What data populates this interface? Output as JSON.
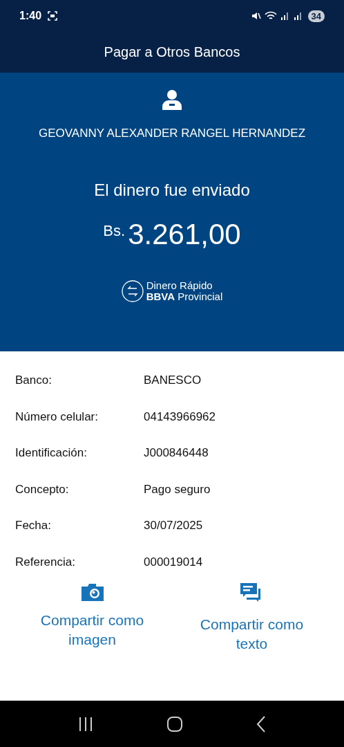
{
  "status_bar": {
    "time": "1:40",
    "battery": "34"
  },
  "header": {
    "title": "Pagar a Otros Bancos"
  },
  "receipt": {
    "recipient": "GEOVANNY ALEXANDER RANGEL HERNANDEZ",
    "message": "El dinero fue enviado",
    "currency": "Bs.",
    "amount": "3.261,00",
    "brand_line_1": "Dinero Rápido",
    "brand_line_2_bold": "BBVA",
    "brand_line_2": "Provincial"
  },
  "details": [
    {
      "label": "Banco:",
      "value": "BANESCO"
    },
    {
      "label": "Número celular:",
      "value": "04143966962"
    },
    {
      "label": "Identificación:",
      "value": "J000846448"
    },
    {
      "label": "Concepto:",
      "value": "Pago seguro"
    },
    {
      "label": "Fecha:",
      "value": "30/07/2025"
    },
    {
      "label": "Referencia:",
      "value": "000019014"
    }
  ],
  "share_actions": [
    {
      "kind": "image",
      "label": "Compartir como imagen"
    },
    {
      "kind": "text",
      "label": "Compartir como texto"
    }
  ]
}
